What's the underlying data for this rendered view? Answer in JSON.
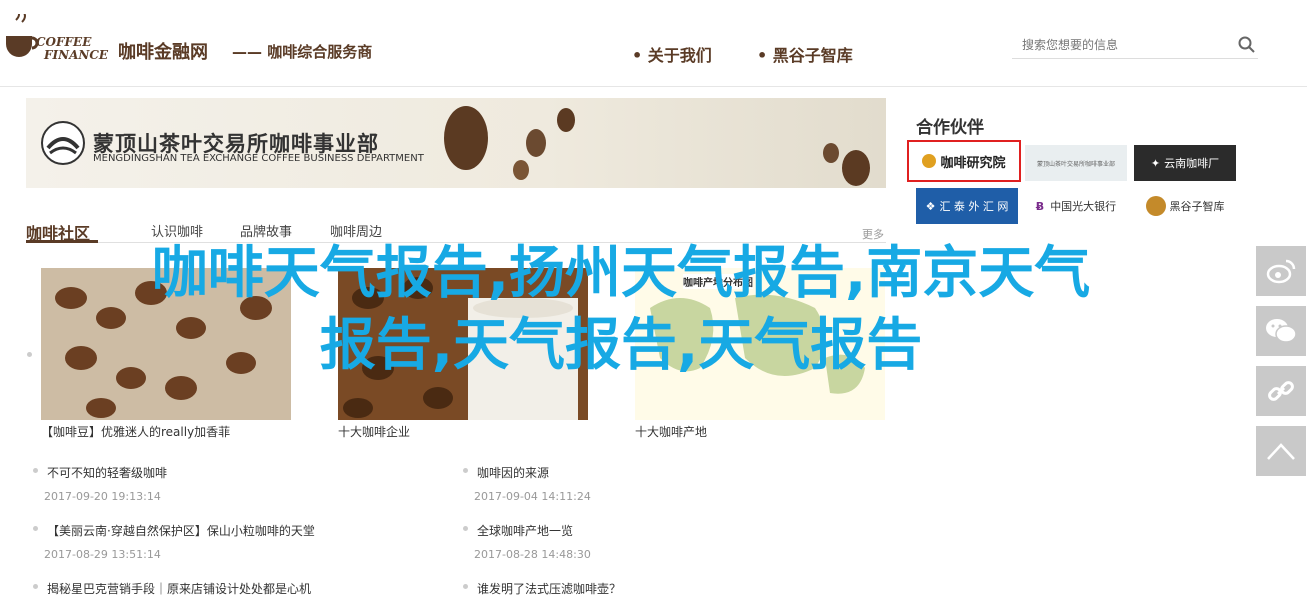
{
  "header": {
    "logo_line1": "COFFEE",
    "logo_line2": "FINANCE",
    "site_name": "咖啡金融网",
    "slogan": "—— 咖啡综合服务商",
    "nav": [
      {
        "label": "• 关于我们"
      },
      {
        "label": "• 黑谷子智库"
      }
    ],
    "search_placeholder": "搜索您想要的信息"
  },
  "banner": {
    "title": "蒙顶山茶叶交易所咖啡事业部",
    "subtitle": "MENGDINGSHAN TEA EXCHANGE COFFEE BUSINESS DEPARTMENT"
  },
  "partners": {
    "title": "合作伙伴",
    "items": [
      {
        "label": "咖啡研究院"
      },
      {
        "label": "蒙顶山茶叶交易所咖啡事业部"
      },
      {
        "label": "云南咖啡厂"
      },
      {
        "label": "汇 泰 外 汇 网"
      },
      {
        "label": "中国光大银行"
      },
      {
        "label": "黑谷子智库"
      }
    ]
  },
  "section": {
    "title": "咖啡社区",
    "tabs": [
      {
        "label": "认识咖啡"
      },
      {
        "label": "品牌故事"
      },
      {
        "label": "咖啡周边"
      }
    ],
    "more": "更多"
  },
  "cards": [
    {
      "caption": "【咖啡豆】优雅迷人的really加香菲"
    },
    {
      "caption": "十大咖啡企业"
    },
    {
      "caption": "十大咖啡产地"
    }
  ],
  "map_label": "咖啡产地分布图",
  "articles_left": [
    {
      "title": "不可不知的轻奢级咖啡",
      "date": "2017-09-20 19:13:14"
    },
    {
      "title": "【美丽云南·穿越自然保护区】保山小粒咖啡的天堂",
      "date": "2017-08-29 13:51:14"
    },
    {
      "title": "揭秘星巴克营销手段｜原来店铺设计处处都是心机",
      "date": ""
    }
  ],
  "articles_right": [
    {
      "title": "咖啡因的来源",
      "date": "2017-09-04 14:11:24"
    },
    {
      "title": "全球咖啡产地一览",
      "date": "2017-08-28 14:48:30"
    },
    {
      "title": "谁发明了法式压滤咖啡壶？",
      "date": ""
    }
  ],
  "overlay": {
    "line1": "咖啡天气报告,扬州天气报告,南京天气",
    "line2": "报告,天气报告,天气报告"
  },
  "colors": {
    "brand": "#5a3b26",
    "overlay": "#17a9e4",
    "share_bg": "#c9c9c9",
    "highlight_border": "#e02020"
  },
  "share_icons": [
    "weibo-icon",
    "wechat-icon",
    "link-icon",
    "back-to-top-icon"
  ]
}
